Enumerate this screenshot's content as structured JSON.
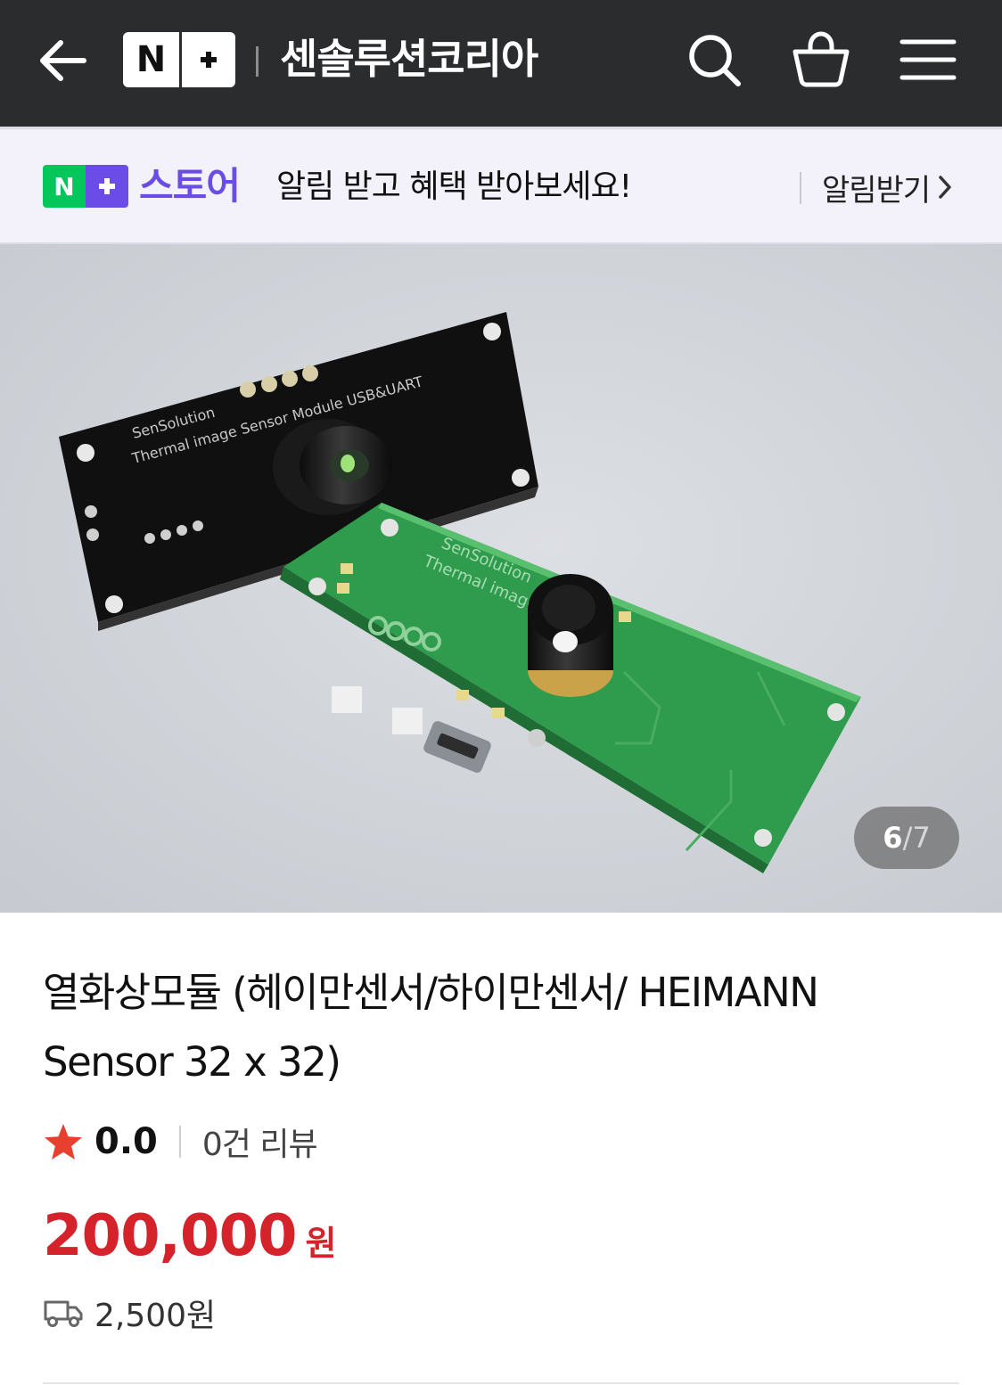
{
  "header": {
    "store_name": "센솔루션코리아",
    "logo_letter": "N",
    "icons": [
      "back-arrow-icon",
      "search-icon",
      "shopping-bag-icon",
      "hamburger-menu-icon"
    ]
  },
  "notify_bar": {
    "badge_letter": "N",
    "store_label": "스토어",
    "message": "알림 받고 혜택 받아보세요!",
    "action_label": "알림받기"
  },
  "gallery": {
    "current": "6",
    "separator": "/",
    "total": "7",
    "board_front_text": [
      "SenSolution",
      "Thermal image"
    ],
    "board_back_text": [
      "SenSolution",
      "Thermal image Sensor Module USB&UART"
    ]
  },
  "product": {
    "title": "열화상모듈 (헤이만센서/하이만센서/ HEIMANN Sensor 32 x 32)",
    "rating": "0.0",
    "review_count": "0건 리뷰",
    "price": "200,000",
    "price_unit": "원",
    "shipping_fee": "2,500원"
  },
  "colors": {
    "header_bg": "#2b2c2e",
    "naver_green": "#03c75a",
    "plus_purple": "#6b4ce6",
    "price_red": "#d4232b",
    "star_red": "#e8402f",
    "notify_bg": "#f3f2fa"
  }
}
